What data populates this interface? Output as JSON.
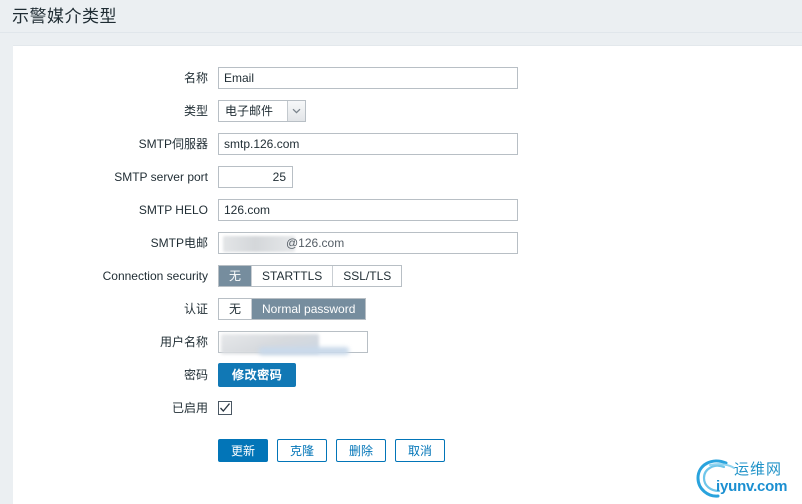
{
  "page": {
    "title": "示警媒介类型",
    "background_color": "#ebeff2",
    "card_color": "#ffffff",
    "accent_color": "#0275b8",
    "selected_segment_color": "#768d9e"
  },
  "form": {
    "name": {
      "label": "名称",
      "value": "Email",
      "placeholder": ""
    },
    "type": {
      "label": "类型",
      "value": "电子邮件",
      "options": [
        "电子邮件"
      ]
    },
    "smtp_server": {
      "label": "SMTP伺服器",
      "value": "smtp.126.com",
      "placeholder": ""
    },
    "smtp_server_port": {
      "label": "SMTP server port",
      "value": "25",
      "placeholder": ""
    },
    "smtp_helo": {
      "label": "SMTP HELO",
      "value": "126.com",
      "placeholder": ""
    },
    "smtp_email": {
      "label": "SMTP电邮",
      "value": "@126.com",
      "redacted": true,
      "placeholder": ""
    },
    "connection_security": {
      "label": "Connection security",
      "options": [
        "无",
        "STARTTLS",
        "SSL/TLS"
      ],
      "selected": "无"
    },
    "authentication": {
      "label": "认证",
      "options": [
        "无",
        "Normal password"
      ],
      "selected": "Normal password"
    },
    "username": {
      "label": "用户名称",
      "value": "",
      "redacted": true,
      "placeholder": ""
    },
    "password": {
      "label": "密码",
      "button_label": "修改密码"
    },
    "enabled": {
      "label": "已启用",
      "checked": true
    }
  },
  "footer": {
    "update_label": "更新",
    "clone_label": "克隆",
    "delete_label": "删除",
    "cancel_label": "取消"
  },
  "watermark": {
    "cn_text": "运维网",
    "en_text": "iyunv.com",
    "color": "#1b8fd1"
  }
}
